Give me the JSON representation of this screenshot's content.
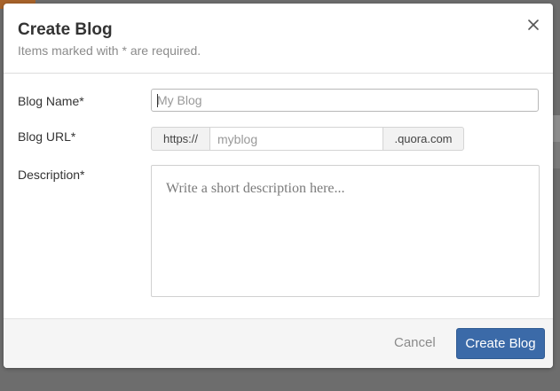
{
  "colors": {
    "primary_button": "#3b6aa8",
    "backdrop": "#6d6d6d",
    "accent": "#a8632a"
  },
  "modal": {
    "title": "Create Blog",
    "subtitle": "Items marked with * are required.",
    "close_icon": "close-icon"
  },
  "form": {
    "blog_name": {
      "label": "Blog Name*",
      "placeholder": "My Blog",
      "value": ""
    },
    "blog_url": {
      "label": "Blog URL*",
      "prefix": "https://",
      "placeholder": "myblog",
      "suffix": ".quora.com",
      "value": ""
    },
    "description": {
      "label": "Description*",
      "placeholder": "Write a short description here...",
      "value": ""
    }
  },
  "footer": {
    "cancel_label": "Cancel",
    "submit_label": "Create Blog"
  }
}
